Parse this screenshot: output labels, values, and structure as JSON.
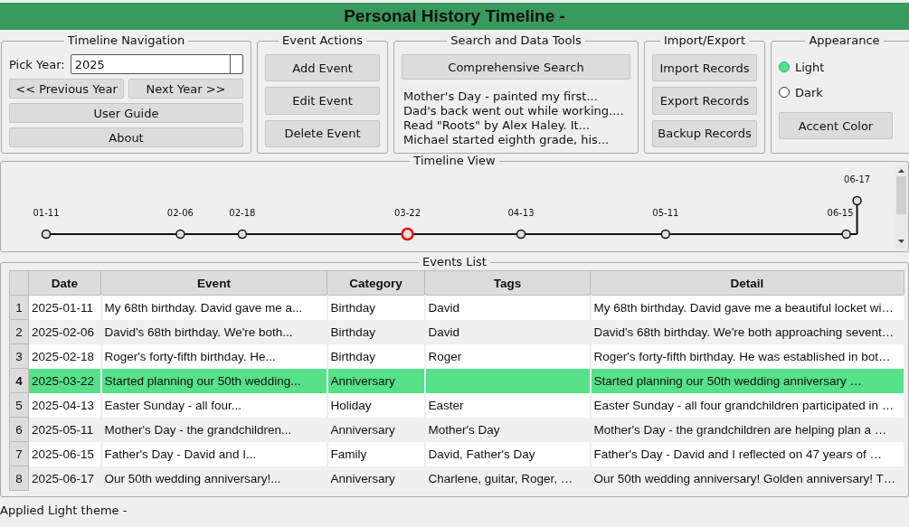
{
  "window": {
    "title": "Personal History Timeline -"
  },
  "navigation": {
    "title": "Timeline Navigation",
    "year_label": "Pick Year:",
    "year_value": "2025",
    "buttons": [
      "<< Previous Year",
      "Next Year >>"
    ],
    "wide_buttons": [
      "User Guide",
      "About"
    ]
  },
  "event_actions": {
    "title": "Event Actions",
    "buttons": [
      "Add Event",
      "Edit Event",
      "Delete Event"
    ]
  },
  "search_tools": {
    "title": "Search and Data Tools",
    "button": "Comprehensive Search",
    "results": [
      "Mother's Day - painted my first...",
      "Dad's back went out while working....",
      "Read \"Roots\" by Alex Haley. It...",
      "Michael started eighth grade, his..."
    ]
  },
  "import_export": {
    "title": "Import/Export",
    "buttons": [
      "Import Records",
      "Export Records",
      "Backup Records"
    ]
  },
  "appearance": {
    "title": "Appearance",
    "themes": [
      {
        "label": "Light",
        "selected": true
      },
      {
        "label": "Dark",
        "selected": false
      }
    ],
    "button": "Accent Color"
  },
  "timeline_view": {
    "title": "Timeline View",
    "markers": [
      {
        "label": "01-11",
        "selected": false
      },
      {
        "label": "02-06",
        "selected": false
      },
      {
        "label": "02-18",
        "selected": false
      },
      {
        "label": "03-22",
        "selected": true
      },
      {
        "label": "04-13",
        "selected": false
      },
      {
        "label": "05-11",
        "selected": false
      },
      {
        "label": "06-15",
        "selected": false
      },
      {
        "label": "06-17",
        "selected": false
      }
    ]
  },
  "events_list": {
    "title": "Events List",
    "columns": [
      "Date",
      "Event",
      "Category",
      "Tags",
      "Detail"
    ],
    "rows": [
      {
        "number": "1",
        "selected": false,
        "cells": [
          "2025-01-11",
          "My 68th birthday. David gave me a...",
          "Birthday",
          "David",
          "My 68th birthday. David gave me a beautiful locket wi…"
        ]
      },
      {
        "number": "2",
        "selected": false,
        "cells": [
          "2025-02-06",
          "David's 68th birthday. We're both...",
          "Birthday",
          "David",
          "David's 68th birthday. We're both approaching sevent…"
        ]
      },
      {
        "number": "3",
        "selected": false,
        "cells": [
          "2025-02-18",
          "Roger's forty-fifth birthday. He...",
          "Birthday",
          "Roger",
          "Roger's forty-fifth birthday. He was established in bot…"
        ]
      },
      {
        "number": "4",
        "selected": true,
        "cells": [
          "2025-03-22",
          "Started planning our 50th wedding...",
          "Anniversary",
          "",
          "Started planning our 50th wedding anniversary …"
        ]
      },
      {
        "number": "5",
        "selected": false,
        "cells": [
          "2025-04-13",
          "Easter Sunday - all four...",
          "Holiday",
          "Easter",
          "Easter Sunday - all four grandchildren participated in …"
        ]
      },
      {
        "number": "6",
        "selected": false,
        "cells": [
          "2025-05-11",
          "Mother's Day - the grandchildren...",
          "Anniversary",
          "Mother's Day",
          "Mother's Day - the grandchildren are helping plan a …"
        ]
      },
      {
        "number": "7",
        "selected": false,
        "cells": [
          "2025-06-15",
          "Father's Day - David and I...",
          "Family",
          "David, Father's Day",
          "Father's Day - David and I reflected on 47 years of …"
        ]
      },
      {
        "number": "8",
        "selected": false,
        "cells": [
          "2025-06-17",
          "Our 50th wedding anniversary!...",
          "Anniversary",
          "Charlene, guitar, Roger, …",
          "Our 50th wedding anniversary! Golden anniversary! T…"
        ]
      }
    ]
  },
  "status_bar": {
    "text": "Applied Light theme -"
  }
}
